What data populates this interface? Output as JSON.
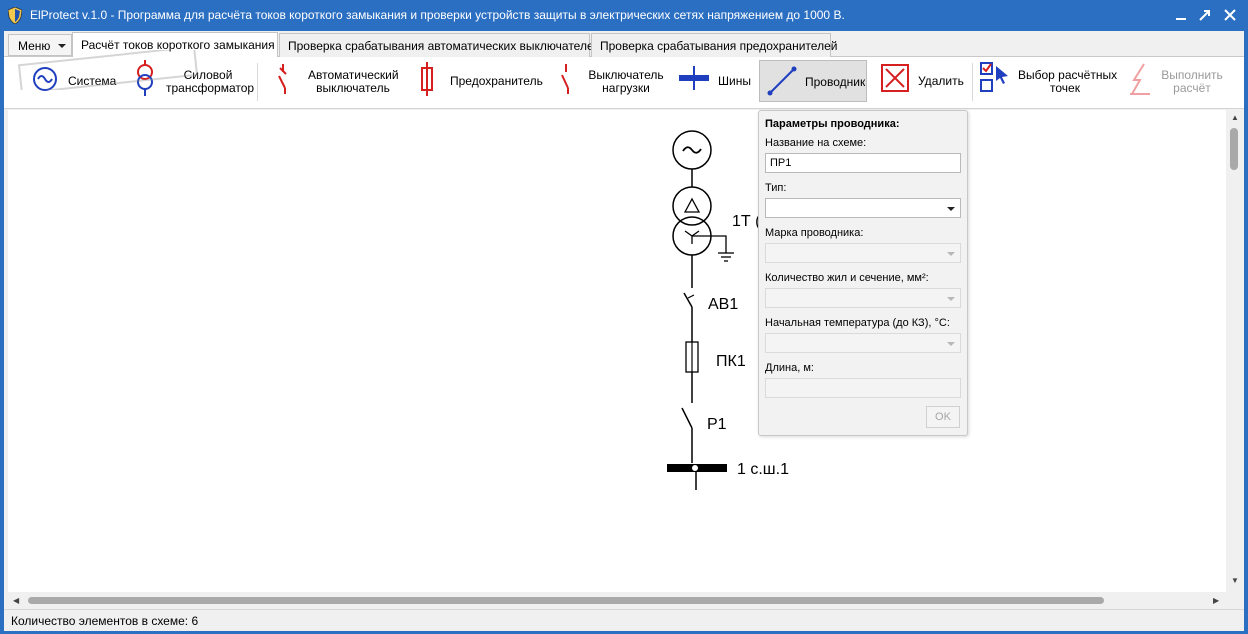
{
  "window": {
    "title": "ElProtect v.1.0 - Программа для расчёта токов короткого замыкания и проверки устройств защиты в электрических сетях напряжением до 1000 В."
  },
  "menu": {
    "label": "Меню"
  },
  "tabs": [
    {
      "label": "Расчёт токов короткого замыкания",
      "active": true
    },
    {
      "label": "Проверка срабатывания автоматических выключателей",
      "active": false
    },
    {
      "label": "Проверка срабатывания предохранителей",
      "active": false
    }
  ],
  "toolbar": {
    "system": "Система",
    "transformer_l1": "Силовой",
    "transformer_l2": "трансформатор",
    "breaker_l1": "Автоматический",
    "breaker_l2": "выключатель",
    "fuse": "Предохранитель",
    "load_switch_l1": "Выключатель",
    "load_switch_l2": "нагрузки",
    "busbar": "Шины",
    "conductor": "Проводник",
    "delete": "Удалить",
    "select_points_l1": "Выбор расчётных",
    "select_points_l2": "точек",
    "run_calc_l1": "Выполнить",
    "run_calc_l2": "расчёт"
  },
  "scheme": {
    "transformer_label": "1Т (",
    "breaker_label": "АВ1",
    "fuse_label": "ПК1",
    "switch_label": "Р1",
    "busbar_label": "1 с.ш.1"
  },
  "panel": {
    "title": "Параметры проводника:",
    "name_label": "Название на схеме:",
    "name_value": "ПР1",
    "type_label": "Тип:",
    "type_value": "",
    "brand_label": "Марка проводника:",
    "cores_label": "Количество жил и сечение, мм²:",
    "temp_label": "Начальная температура (до КЗ), °С:",
    "length_label": "Длина, м:",
    "length_value": "",
    "ok": "OK"
  },
  "status": {
    "text": "Количество элементов в схеме: 6"
  },
  "colors": {
    "titlebar": "#2b6fc2",
    "accent_red": "#d62020",
    "accent_blue": "#1f3fbf"
  }
}
